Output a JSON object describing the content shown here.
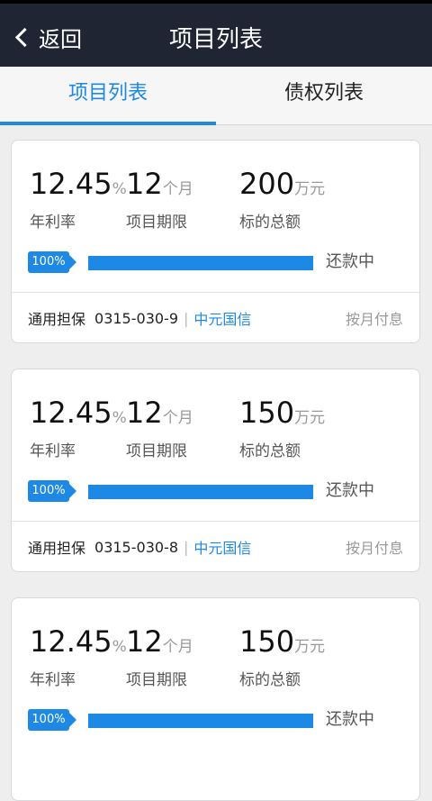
{
  "nav": {
    "back_label": "返回",
    "title": "项目列表"
  },
  "tabs": [
    {
      "label": "项目列表",
      "active": true
    },
    {
      "label": "债权列表",
      "active": false
    }
  ],
  "projects": [
    {
      "rate": "12.45",
      "rate_unit": "%",
      "rate_label": "年利率",
      "term": "12",
      "term_unit": "个月",
      "term_label": "项目期限",
      "amount": "200",
      "amount_unit": "万元",
      "amount_label": "标的总额",
      "progress": "100%",
      "progress_value": 100,
      "status": "还款中",
      "guarantee": "通用担保",
      "code": "0315-030-9",
      "org": "中元国信",
      "repay": "按月付息"
    },
    {
      "rate": "12.45",
      "rate_unit": "%",
      "rate_label": "年利率",
      "term": "12",
      "term_unit": "个月",
      "term_label": "项目期限",
      "amount": "150",
      "amount_unit": "万元",
      "amount_label": "标的总额",
      "progress": "100%",
      "progress_value": 100,
      "status": "还款中",
      "guarantee": "通用担保",
      "code": "0315-030-8",
      "org": "中元国信",
      "repay": "按月付息"
    },
    {
      "rate": "12.45",
      "rate_unit": "%",
      "rate_label": "年利率",
      "term": "12",
      "term_unit": "个月",
      "term_label": "项目期限",
      "amount": "150",
      "amount_unit": "万元",
      "amount_label": "标的总额",
      "progress": "100%",
      "progress_value": 100,
      "status": "还款中",
      "guarantee": "",
      "code": "",
      "org": "",
      "repay": ""
    }
  ],
  "colors": {
    "accent": "#1e88e5",
    "navbar": "#1f2533"
  }
}
